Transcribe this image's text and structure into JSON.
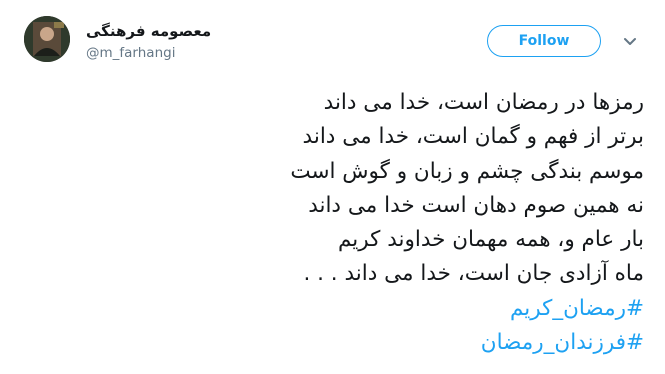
{
  "user": {
    "display_name": "معصومه فرهنگی",
    "handle": "@m_farhangi",
    "avatar_icon": "profile-photo-avatar"
  },
  "actions": {
    "follow_label": "Follow",
    "menu_icon": "chevron-down-icon"
  },
  "tweet": {
    "lines": [
      "رمزها در رمضان است، خدا می داند",
      "برتر از فهم و گمان است، خدا می داند",
      "موسم بندگی چشم و زبان و گوش است",
      "نه همین صوم دهان است خدا می داند",
      "بار عام و، همه مهمان خداوند کریم",
      "ماه آزادی جان است، خدا می داند . . ."
    ],
    "hashtags": [
      "#رمضان_کریم",
      "#فرزندان_رمضان"
    ]
  },
  "colors": {
    "accent": "#1da1f2",
    "text": "#14171a",
    "muted": "#657786"
  }
}
